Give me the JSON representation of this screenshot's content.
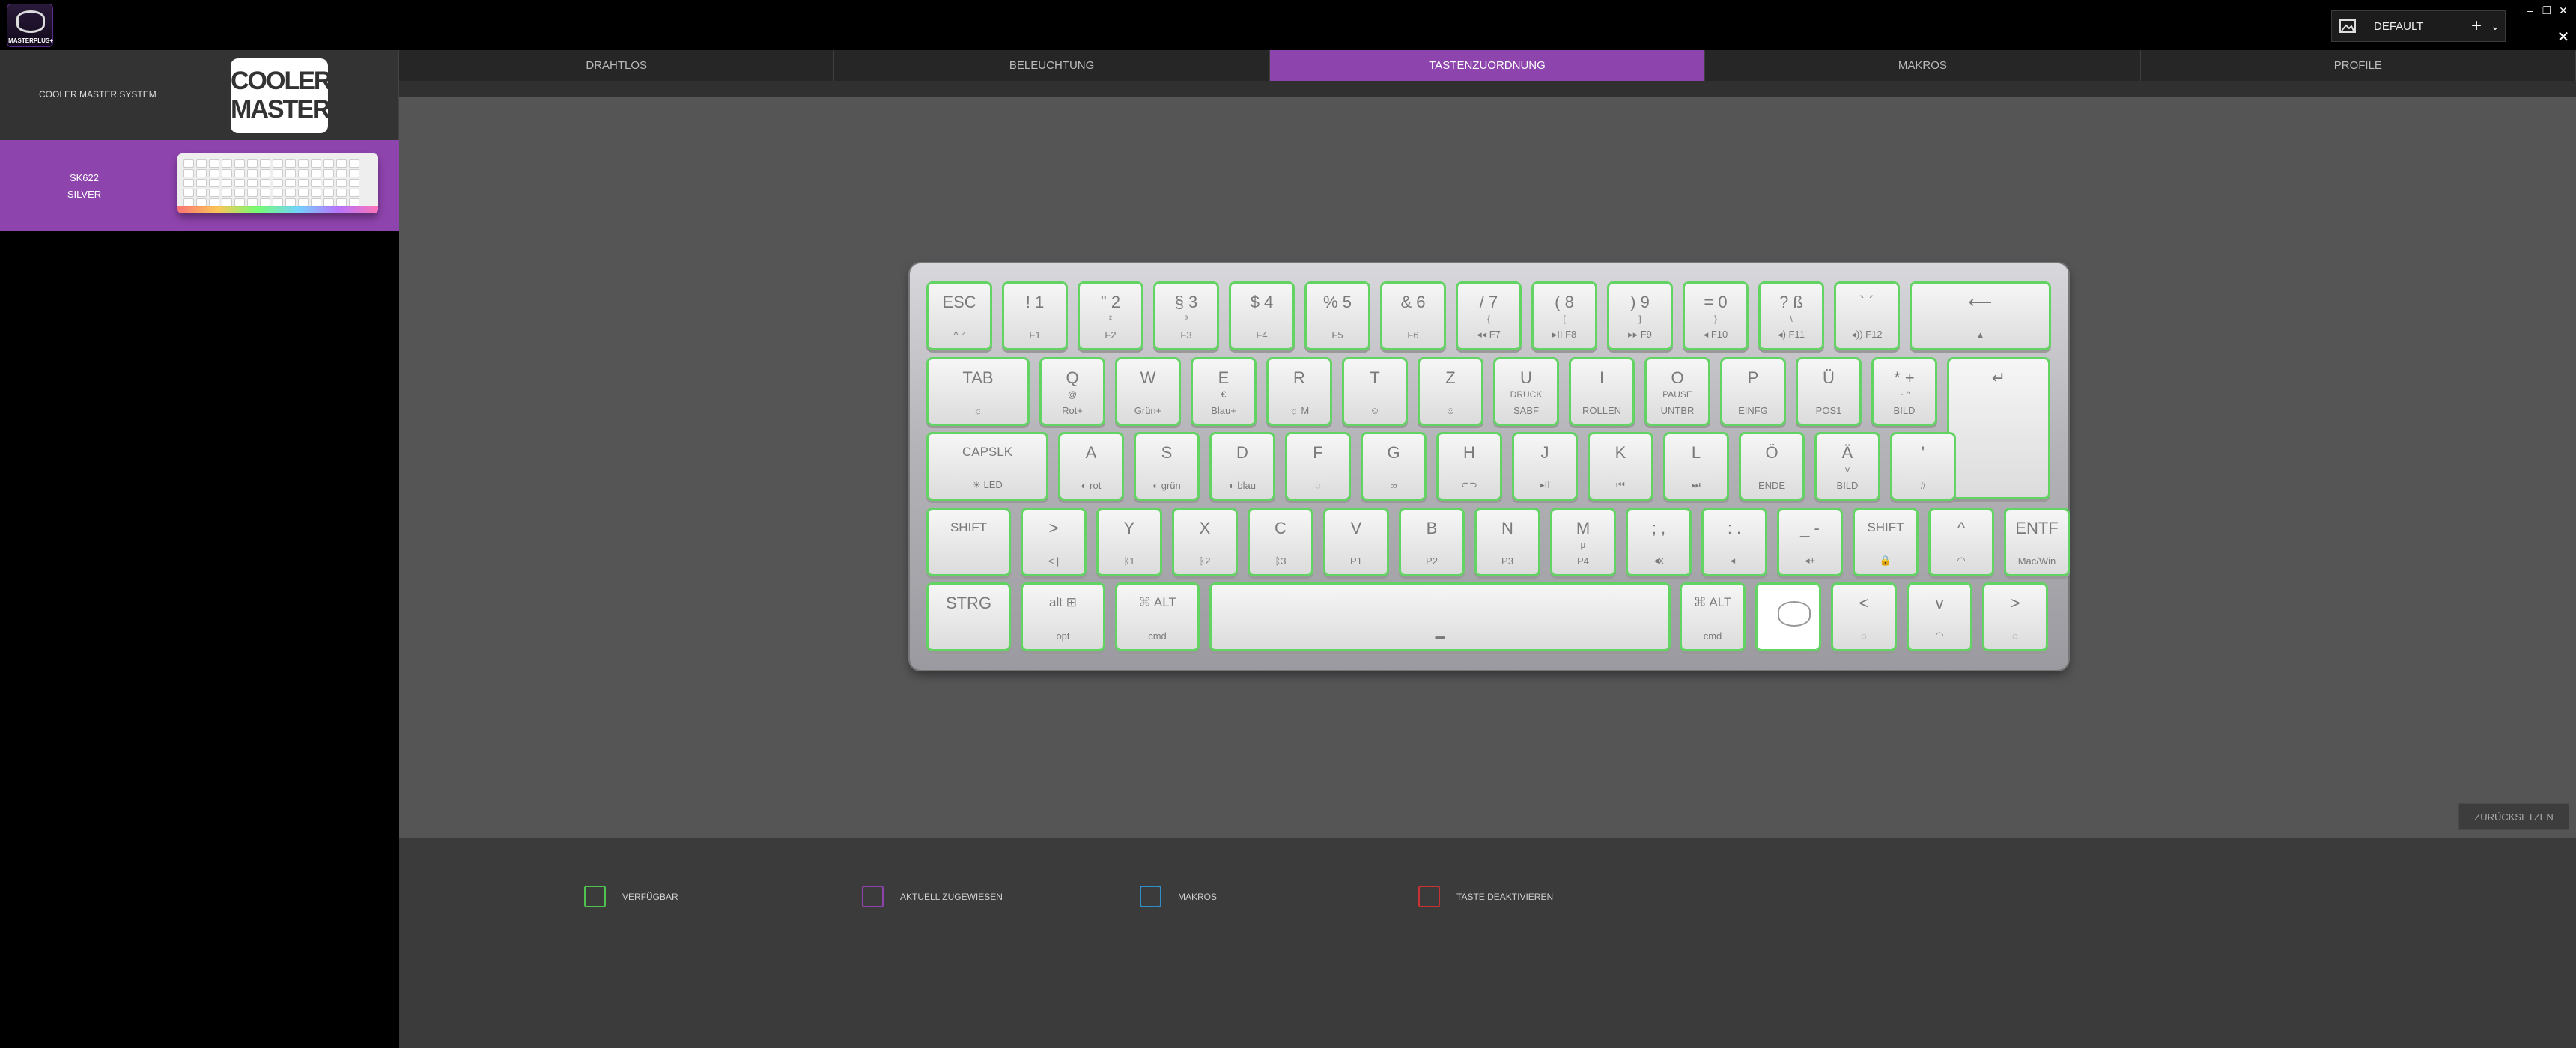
{
  "app": {
    "logo_text": "MASTERPLUS+"
  },
  "profile": {
    "name": "DEFAULT",
    "add_icon": "plus-icon",
    "dropdown_icon": "chevron-down-icon"
  },
  "window": {
    "minimize": "‒",
    "restore": "❐",
    "close": "✕",
    "panel_close": "✕"
  },
  "sidebar": {
    "system_label": "COOLER MASTER SYSTEM",
    "brand_logo": [
      "COOLER",
      "MASTER"
    ],
    "device": {
      "name_line1": "SK622",
      "name_line2": "SILVER"
    }
  },
  "tabs": [
    {
      "label": "DRAHTLOS",
      "active": false
    },
    {
      "label": "BELEUCHTUNG",
      "active": false
    },
    {
      "label": "TASTENZUORDNUNG",
      "active": true
    },
    {
      "label": "MAKROS",
      "active": false
    },
    {
      "label": "PROFILE",
      "active": false
    }
  ],
  "reset_button": "ZURÜCKSETZEN",
  "keyboard": {
    "rows": [
      [
        {
          "top": "ESC",
          "bottom": "^ °"
        },
        {
          "top": "! 1",
          "bottom": "F1"
        },
        {
          "top": "\" 2",
          "mid": "²",
          "bottom": "F2"
        },
        {
          "top": "§ 3",
          "mid": "³",
          "bottom": "F3"
        },
        {
          "top": "$ 4",
          "bottom": "F4"
        },
        {
          "top": "% 5",
          "bottom": "F5"
        },
        {
          "top": "& 6",
          "bottom": "F6"
        },
        {
          "top": "/ 7",
          "mid": "{",
          "bottom": "◂◂ F7"
        },
        {
          "top": "( 8",
          "mid": "[",
          "bottom": "▸II F8"
        },
        {
          "top": ") 9",
          "mid": "]",
          "bottom": "▸▸ F9"
        },
        {
          "top": "= 0",
          "mid": "}",
          "bottom": "◂ F10"
        },
        {
          "top": "? ß",
          "mid": "\\",
          "bottom": "◂) F11"
        },
        {
          "top": "` ´",
          "bottom": "◂)) F12"
        },
        {
          "top": "⟵",
          "bottom": "▲"
        }
      ],
      [
        {
          "top": "TAB",
          "bottom": "☼"
        },
        {
          "top": "Q",
          "mid": "@",
          "bottom": "Rot+"
        },
        {
          "top": "W",
          "bottom": "Grün+"
        },
        {
          "top": "E",
          "mid": "€",
          "bottom": "Blau+"
        },
        {
          "top": "R",
          "bottom": "☼ M"
        },
        {
          "top": "T",
          "bottom": "☺"
        },
        {
          "top": "Z",
          "bottom": "☺"
        },
        {
          "top": "U",
          "mid": "DRUCK",
          "bottom": "SABF"
        },
        {
          "top": "I",
          "bottom": "ROLLEN"
        },
        {
          "top": "O",
          "mid": "PAUSE",
          "bottom": "UNTBR"
        },
        {
          "top": "P",
          "bottom": "EINFG"
        },
        {
          "top": "Ü",
          "bottom": "POS1"
        },
        {
          "top": "* +",
          "mid": "~ ^",
          "bottom": "BILD"
        },
        {
          "top": "↵",
          "bottom": ""
        }
      ],
      [
        {
          "top": "CAPSLK",
          "bottom": "☀ LED"
        },
        {
          "top": "A",
          "bottom": "◐ rot"
        },
        {
          "top": "S",
          "bottom": "◐ grün"
        },
        {
          "top": "D",
          "bottom": "◐ blau"
        },
        {
          "top": "F",
          "bottom": "◌"
        },
        {
          "top": "G",
          "bottom": "∞"
        },
        {
          "top": "H",
          "bottom": "⊂⊃"
        },
        {
          "top": "J",
          "bottom": "▸II"
        },
        {
          "top": "K",
          "bottom": "⏮"
        },
        {
          "top": "L",
          "bottom": "⏭"
        },
        {
          "top": "Ö",
          "bottom": "ENDE"
        },
        {
          "top": "Ä",
          "mid": "v",
          "bottom": "BILD"
        },
        {
          "top": "'",
          "bottom": "#"
        }
      ],
      [
        {
          "top": "SHIFT",
          "bottom": ""
        },
        {
          "top": ">",
          "bottom": "< |"
        },
        {
          "top": "Y",
          "bottom": "ᛒ1"
        },
        {
          "top": "X",
          "bottom": "ᛒ2"
        },
        {
          "top": "C",
          "bottom": "ᛒ3"
        },
        {
          "top": "V",
          "bottom": "P1"
        },
        {
          "top": "B",
          "bottom": "P2"
        },
        {
          "top": "N",
          "bottom": "P3"
        },
        {
          "top": "M",
          "mid": "µ",
          "bottom": "P4"
        },
        {
          "top": "; ,",
          "bottom": "◂x"
        },
        {
          "top": ": .",
          "bottom": "◂-"
        },
        {
          "top": "_ -",
          "bottom": "◂+"
        },
        {
          "top": "SHIFT",
          "bottom": "🔒"
        },
        {
          "top": "^",
          "bottom": "◠"
        },
        {
          "top": "ENTF",
          "bottom": "Mac/Win"
        }
      ],
      [
        {
          "top": "STRG",
          "bottom": ""
        },
        {
          "top": "alt  ⊞",
          "bottom": "opt"
        },
        {
          "top": "⌘  ALT",
          "bottom": "cmd"
        },
        {
          "top": "",
          "bottom": "▬"
        },
        {
          "top": "⌘  ALT",
          "bottom": "cmd"
        },
        {
          "top": "",
          "bottom": ""
        },
        {
          "top": "<",
          "bottom": "◌"
        },
        {
          "top": "v",
          "bottom": "◠"
        },
        {
          "top": ">",
          "bottom": "◌"
        }
      ]
    ]
  },
  "legend": [
    {
      "label": "VERFÜGBAR",
      "color": "#4fc24f"
    },
    {
      "label": "AKTUELL ZUGEWIESEN",
      "color": "#8e44ad"
    },
    {
      "label": "MAKROS",
      "color": "#2f8fc8"
    },
    {
      "label": "TASTE DEAKTIVIEREN",
      "color": "#c83232"
    }
  ]
}
